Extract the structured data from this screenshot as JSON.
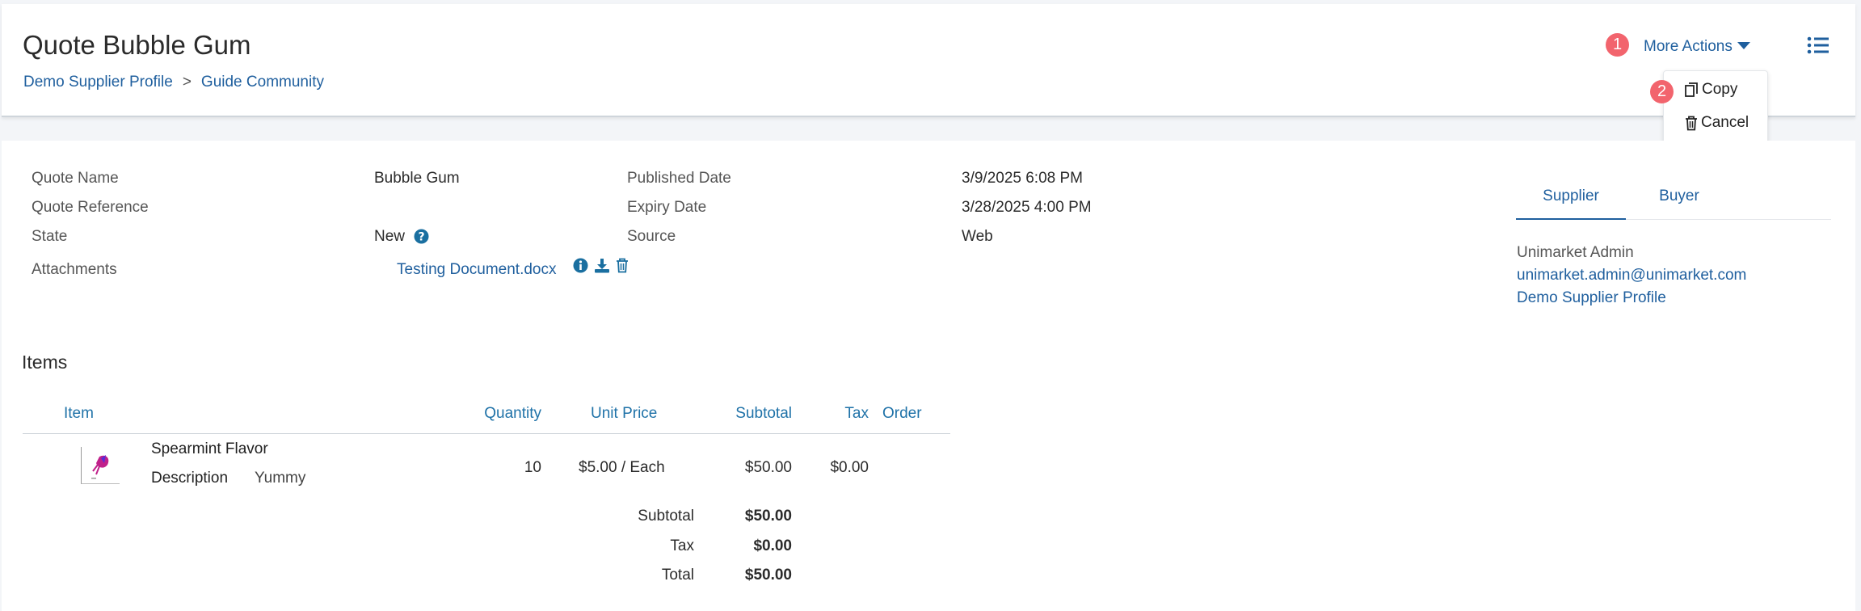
{
  "header": {
    "title": "Quote Bubble Gum",
    "breadcrumb": [
      "Demo Supplier Profile",
      ">",
      "Guide Community"
    ],
    "more_actions_label": "More Actions",
    "badges": [
      "1",
      "2"
    ],
    "dropdown": {
      "copy_label": "Copy",
      "cancel_label": "Cancel"
    }
  },
  "details": {
    "quote_name_label": "Quote Name",
    "quote_name_value": "Bubble Gum",
    "quote_reference_label": "Quote Reference",
    "state_label": "State",
    "state_value": "New",
    "attachments_label": "Attachments",
    "attachment_file": "Testing Document.docx",
    "published_date_label": "Published Date",
    "published_date_value": "3/9/2025 6:08 PM",
    "expiry_date_label": "Expiry Date",
    "expiry_date_value": "3/28/2025 4:00 PM",
    "source_label": "Source",
    "source_value": "Web"
  },
  "side_panel": {
    "tabs": [
      "Supplier",
      "Buyer"
    ],
    "active_tab": "Supplier",
    "contact_name": "Unimarket Admin",
    "contact_email": "unimarket.admin@unimarket.com",
    "contact_org": "Demo Supplier Profile"
  },
  "items": {
    "title": "Items",
    "columns": [
      "Item",
      "Quantity",
      "Unit Price",
      "Subtotal",
      "Tax",
      "Order"
    ],
    "rows": [
      {
        "name": "Spearmint Flavor",
        "description_label": "Description",
        "description": "Yummy",
        "quantity": "10",
        "unit_price": "$5.00 / Each",
        "subtotal": "$50.00",
        "tax": "$0.00"
      }
    ],
    "totals": {
      "subtotal_label": "Subtotal",
      "subtotal_value": "$50.00",
      "tax_label": "Tax",
      "tax_value": "$0.00",
      "total_label": "Total",
      "total_value": "$50.00"
    }
  },
  "colors": {
    "link": "#1f5f9e",
    "badge": "#f2646d",
    "table_header": "#1f72a8"
  },
  "icons": [
    "help-circle-icon",
    "info-icon",
    "download-icon",
    "trash-icon",
    "copy-icon",
    "list-icon",
    "caret-down-icon"
  ]
}
